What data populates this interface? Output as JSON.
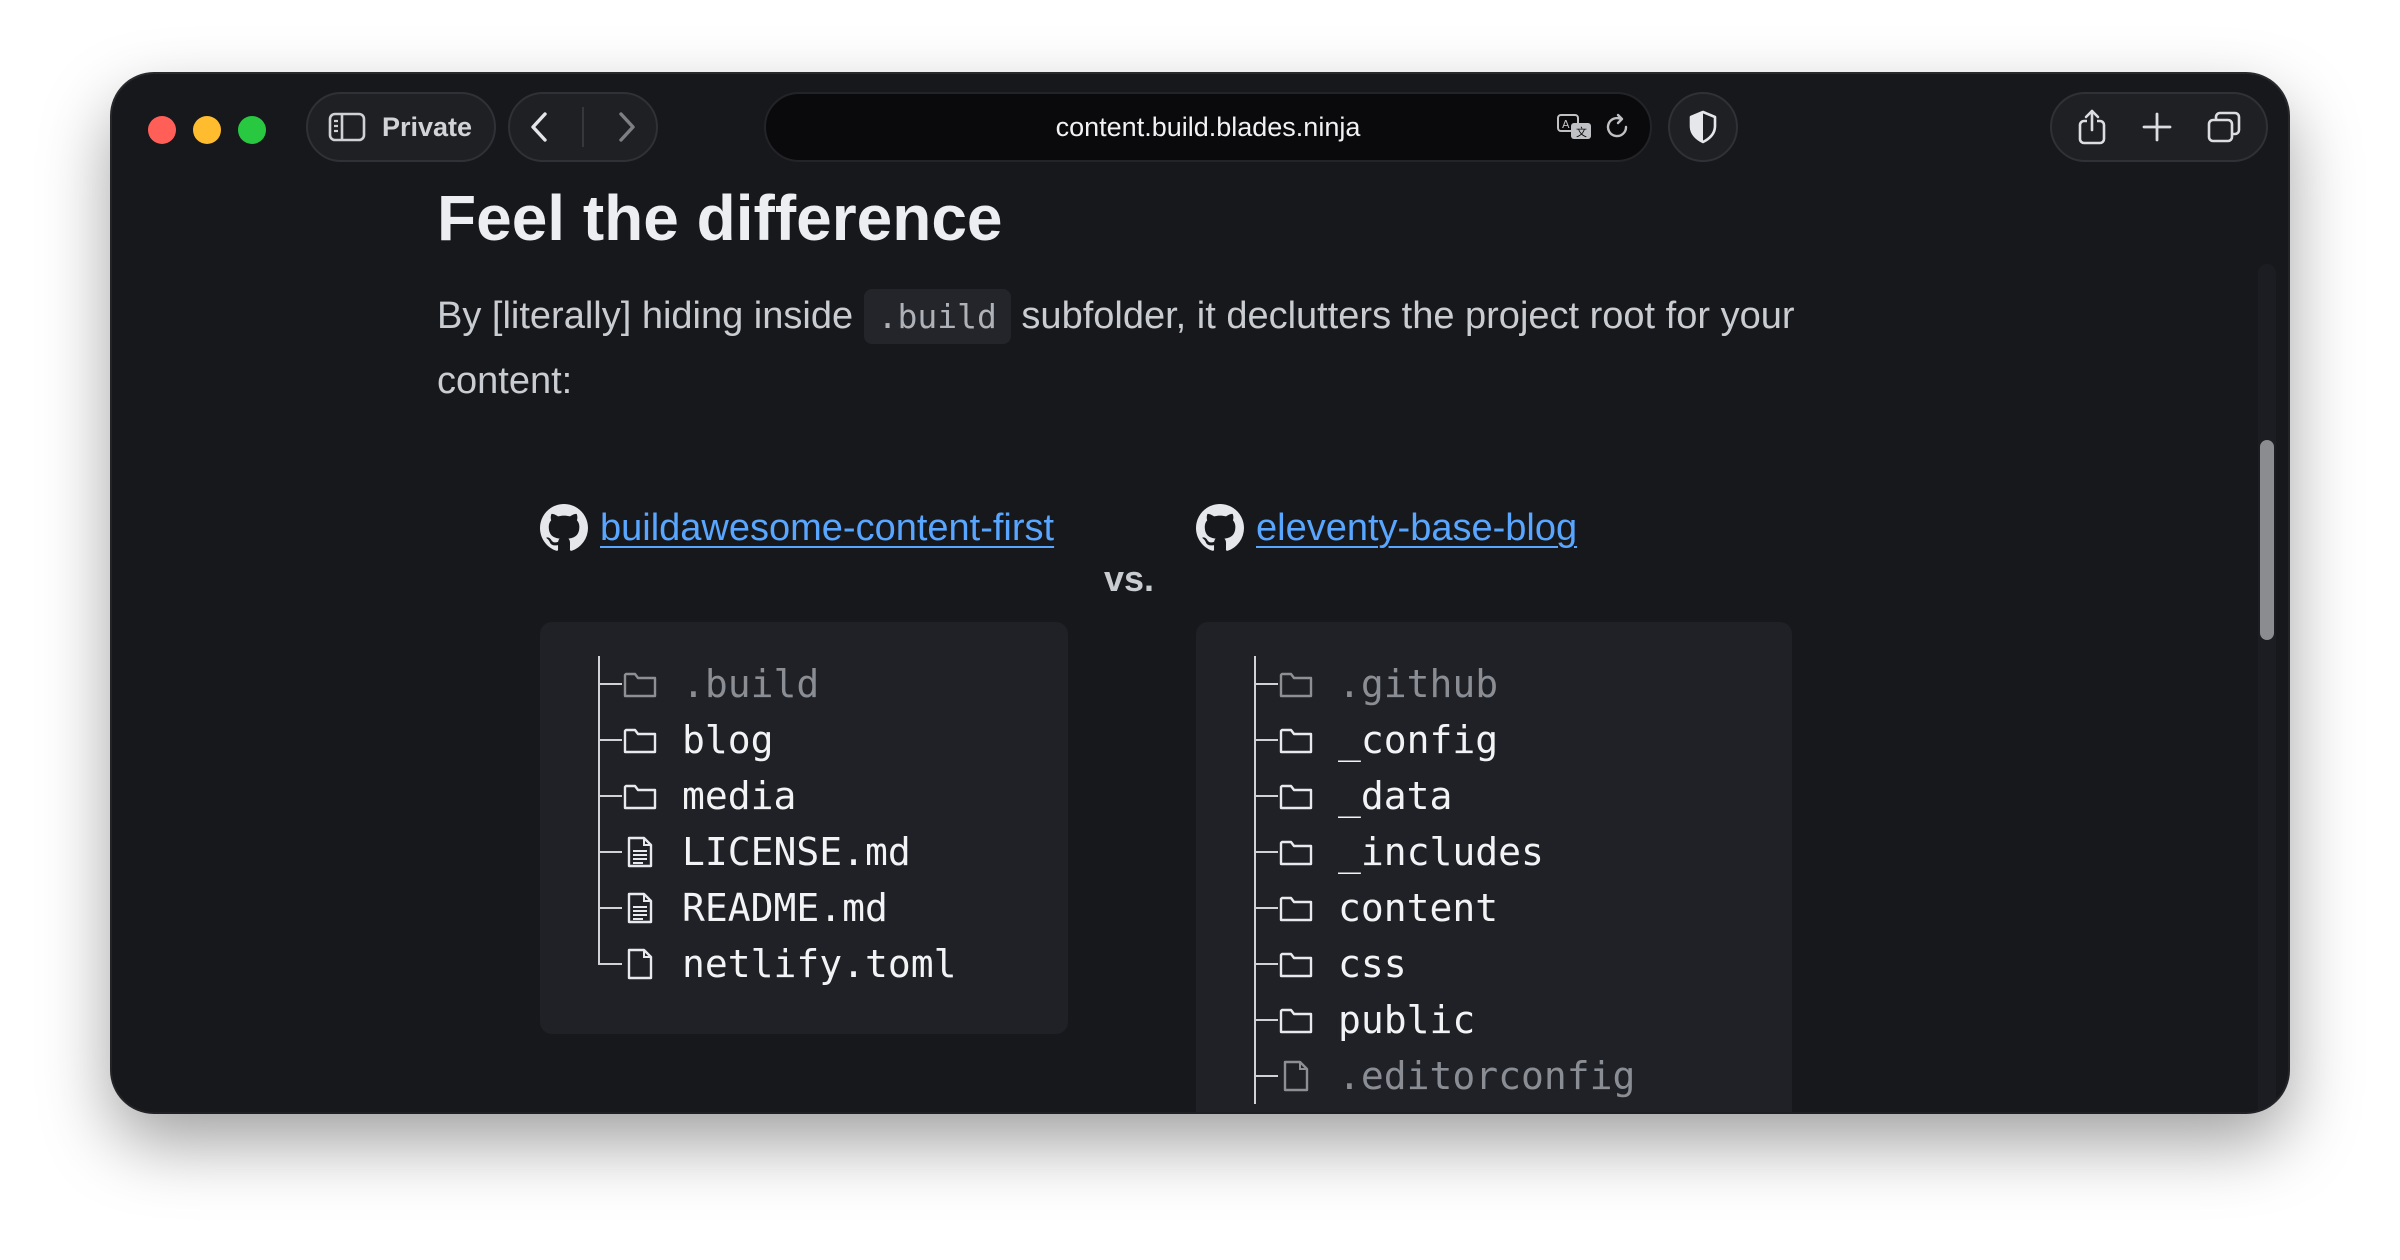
{
  "browser": {
    "private_label": "Private",
    "url": "content.build.blades.ninja",
    "lights": [
      "#ff5f57",
      "#febc2e",
      "#28c840"
    ]
  },
  "article": {
    "heading": "Feel the difference",
    "para_before": "By [literally] hiding inside ",
    "para_code": ".build",
    "para_after": " subfolder, it declutters the project root for your content:",
    "vs": "vs."
  },
  "repos": {
    "left": {
      "name": "buildawesome-content-first",
      "files": [
        {
          "name": ".build",
          "type": "folder",
          "dim": true
        },
        {
          "name": "blog",
          "type": "folder",
          "dim": false
        },
        {
          "name": "media",
          "type": "folder",
          "dim": false
        },
        {
          "name": "LICENSE.md",
          "type": "doc",
          "dim": false
        },
        {
          "name": "README.md",
          "type": "doc",
          "dim": false
        },
        {
          "name": "netlify.toml",
          "type": "file",
          "dim": false
        }
      ]
    },
    "right": {
      "name": "eleventy-base-blog",
      "files": [
        {
          "name": ".github",
          "type": "folder",
          "dim": true
        },
        {
          "name": "_config",
          "type": "folder",
          "dim": false
        },
        {
          "name": "_data",
          "type": "folder",
          "dim": false
        },
        {
          "name": "_includes",
          "type": "folder",
          "dim": false
        },
        {
          "name": "content",
          "type": "folder",
          "dim": false
        },
        {
          "name": "css",
          "type": "folder",
          "dim": false
        },
        {
          "name": "public",
          "type": "folder",
          "dim": false
        },
        {
          "name": ".editorconfig",
          "type": "file",
          "dim": true
        }
      ]
    }
  },
  "colors": {
    "link": "#58a6ff",
    "background": "#17181c",
    "panel": "#1f2127"
  }
}
